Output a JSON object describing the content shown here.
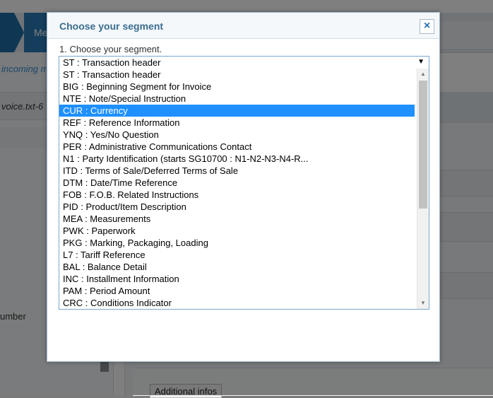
{
  "background": {
    "breadcrumb_item": "Me",
    "sidebar_item_1": "incoming m",
    "sidebar_item_2": "voice.txt-6",
    "sidebar_label": "umber",
    "additional_button": "Additional infos"
  },
  "modal": {
    "title": "Choose your segment",
    "close_icon": "×",
    "field_label": "1. Choose your segment.",
    "selected_value": "ST : Transaction header",
    "dropdown_arrow": "▼",
    "options": [
      "ST : Transaction header",
      "BIG : Beginning Segment for Invoice",
      "NTE : Note/Special Instruction",
      "CUR : Currency",
      "REF : Reference Information",
      "YNQ : Yes/No Question",
      "PER : Administrative Communications Contact",
      "N1 : Party Identification (starts SG10700 : N1-N2-N3-N4-R...",
      "ITD : Terms of Sale/Deferred Terms of Sale",
      "DTM : Date/Time Reference",
      "FOB : F.O.B. Related Instructions",
      "PID : Product/Item Description",
      "MEA : Measurements",
      "PWK : Paperwork",
      "PKG : Marking, Packaging, Loading",
      "L7 : Tariff Reference",
      "BAL : Balance Detail",
      "INC : Installment Information",
      "PAM : Period Amount",
      "CRC : Conditions Indicator"
    ],
    "highlighted_option": "CUR : Currency",
    "scroll_up_icon": "▲",
    "scroll_down_icon": "▼"
  },
  "colors": {
    "title_color": "#3a6d8f",
    "highlight": "#1e90ff",
    "close_icon": "#2a72b5",
    "border": "#7aa7cf"
  }
}
